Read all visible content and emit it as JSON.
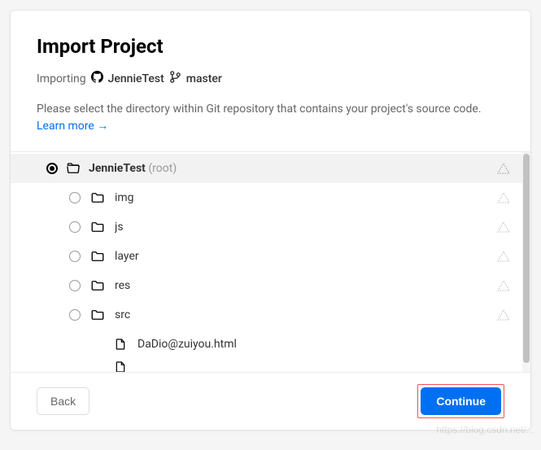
{
  "title": "Import Project",
  "importing": {
    "label": "Importing",
    "repo": "JennieTest",
    "branch": "master"
  },
  "description": {
    "text": "Please select the directory within Git repository that contains your project's source code.",
    "learn_more": "Learn more →"
  },
  "tree": {
    "root": {
      "name": "JennieTest",
      "suffix": "(root)"
    },
    "folders": [
      {
        "name": "img"
      },
      {
        "name": "js"
      },
      {
        "name": "layer"
      },
      {
        "name": "res"
      },
      {
        "name": "src"
      }
    ],
    "files": [
      {
        "name": "DaDio@zuiyou.html"
      }
    ],
    "partial_file": ""
  },
  "footer": {
    "back": "Back",
    "continue": "Continue"
  },
  "watermark": "https://blog.csdn.net/..."
}
